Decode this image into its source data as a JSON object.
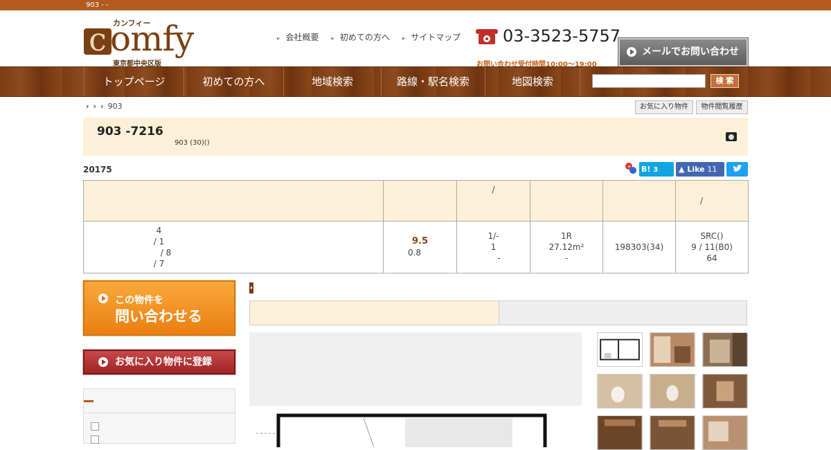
{
  "topbar": {
    "text": "903 -  -"
  },
  "logo": {
    "kana": "カンフィー",
    "big_c": "c",
    "word": "omfy",
    "area": "東京都中央区版"
  },
  "toplinks": [
    "会社概要",
    "初めての方へ",
    "サイトマップ"
  ],
  "phone": {
    "number": "03-3523-5757",
    "hours": "お問い合わせ受付時間10:00～19:00"
  },
  "mail_button": "メールでお問い合わせ",
  "nav": [
    "トップページ",
    "初めての方へ",
    "地域検索",
    "路線・駅名検索",
    "地図検索"
  ],
  "search": {
    "button": "検 索",
    "placeholder": ""
  },
  "breadcrumb": {
    "sep": "›",
    "current": "903"
  },
  "tag_buttons": [
    "お気に入り物件",
    "物件閲覧履歴"
  ],
  "title": {
    "main": "903 -7216",
    "sub": "903 (30)()"
  },
  "date": "20175",
  "social": {
    "hatena": "B!",
    "hatena_count": "3",
    "like": "Like",
    "like_count": "11"
  },
  "table": {
    "headers": [
      "",
      "",
      "/",
      "",
      "",
      "/"
    ],
    "row": {
      "access": [
        "4",
        "/ 1",
        "/ 8",
        "/ 7"
      ],
      "rent": "9.5",
      "rent_sub": "0.8",
      "deposit": [
        "1/-",
        "1",
        "-"
      ],
      "layout": [
        "1R",
        "27.12m²",
        "-"
      ],
      "built": "198303(34)",
      "structure": [
        "SRC()",
        "9 / 11(B0)",
        "64"
      ]
    }
  },
  "inquiry_button": {
    "small": "この物件を",
    "large": "問い合わせる"
  },
  "favorite_button": "お気に入り物件に登録",
  "colors": {
    "brand": "#b45a1e",
    "nav": "#7a3c14",
    "cream": "#fdf0d8",
    "orange": "#f39a25",
    "red": "#b0363a"
  }
}
